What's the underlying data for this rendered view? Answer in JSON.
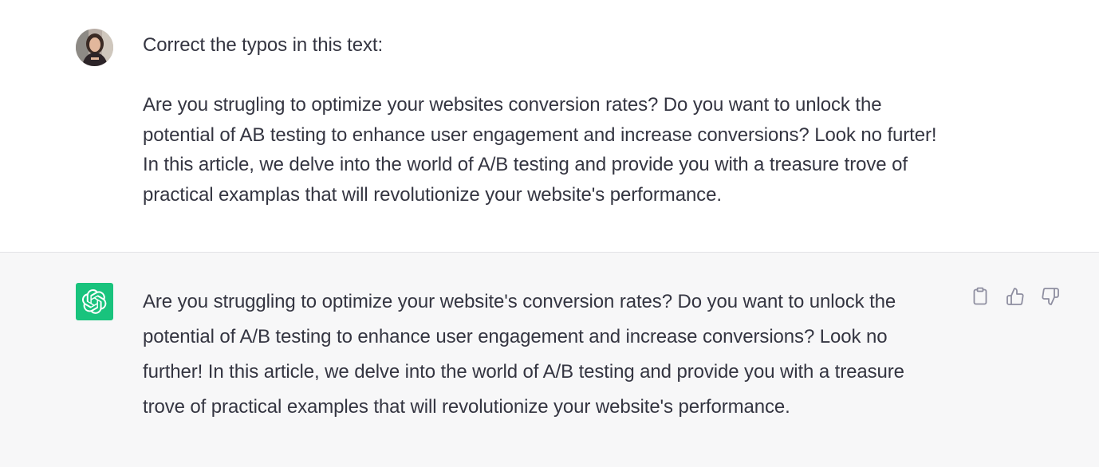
{
  "user_turn": {
    "avatar": "user-avatar-photo",
    "prompt": "Correct the typos in this text:",
    "text": "Are you strugling to optimize your websites conversion rates? Do you want to unlock the potential of AB testing to enhance user engagement and increase conversions? Look no furter! In this article, we delve into the world of A/B testing and provide you with a treasure trove of practical examplas that will revolutionize your website's performance."
  },
  "assistant_turn": {
    "avatar": "openai-logo-icon",
    "accent_color": "#19c37d",
    "text": "Are you struggling to optimize your website's conversion rates? Do you want to unlock the potential of A/B testing to enhance user engagement and increase conversions? Look no further! In this article, we delve into the world of A/B testing and provide you with a treasure trove of practical examples that will revolutionize your website's performance.",
    "actions": [
      {
        "icon": "clipboard-icon"
      },
      {
        "icon": "thumbs-up-icon"
      },
      {
        "icon": "thumbs-down-icon"
      }
    ]
  }
}
